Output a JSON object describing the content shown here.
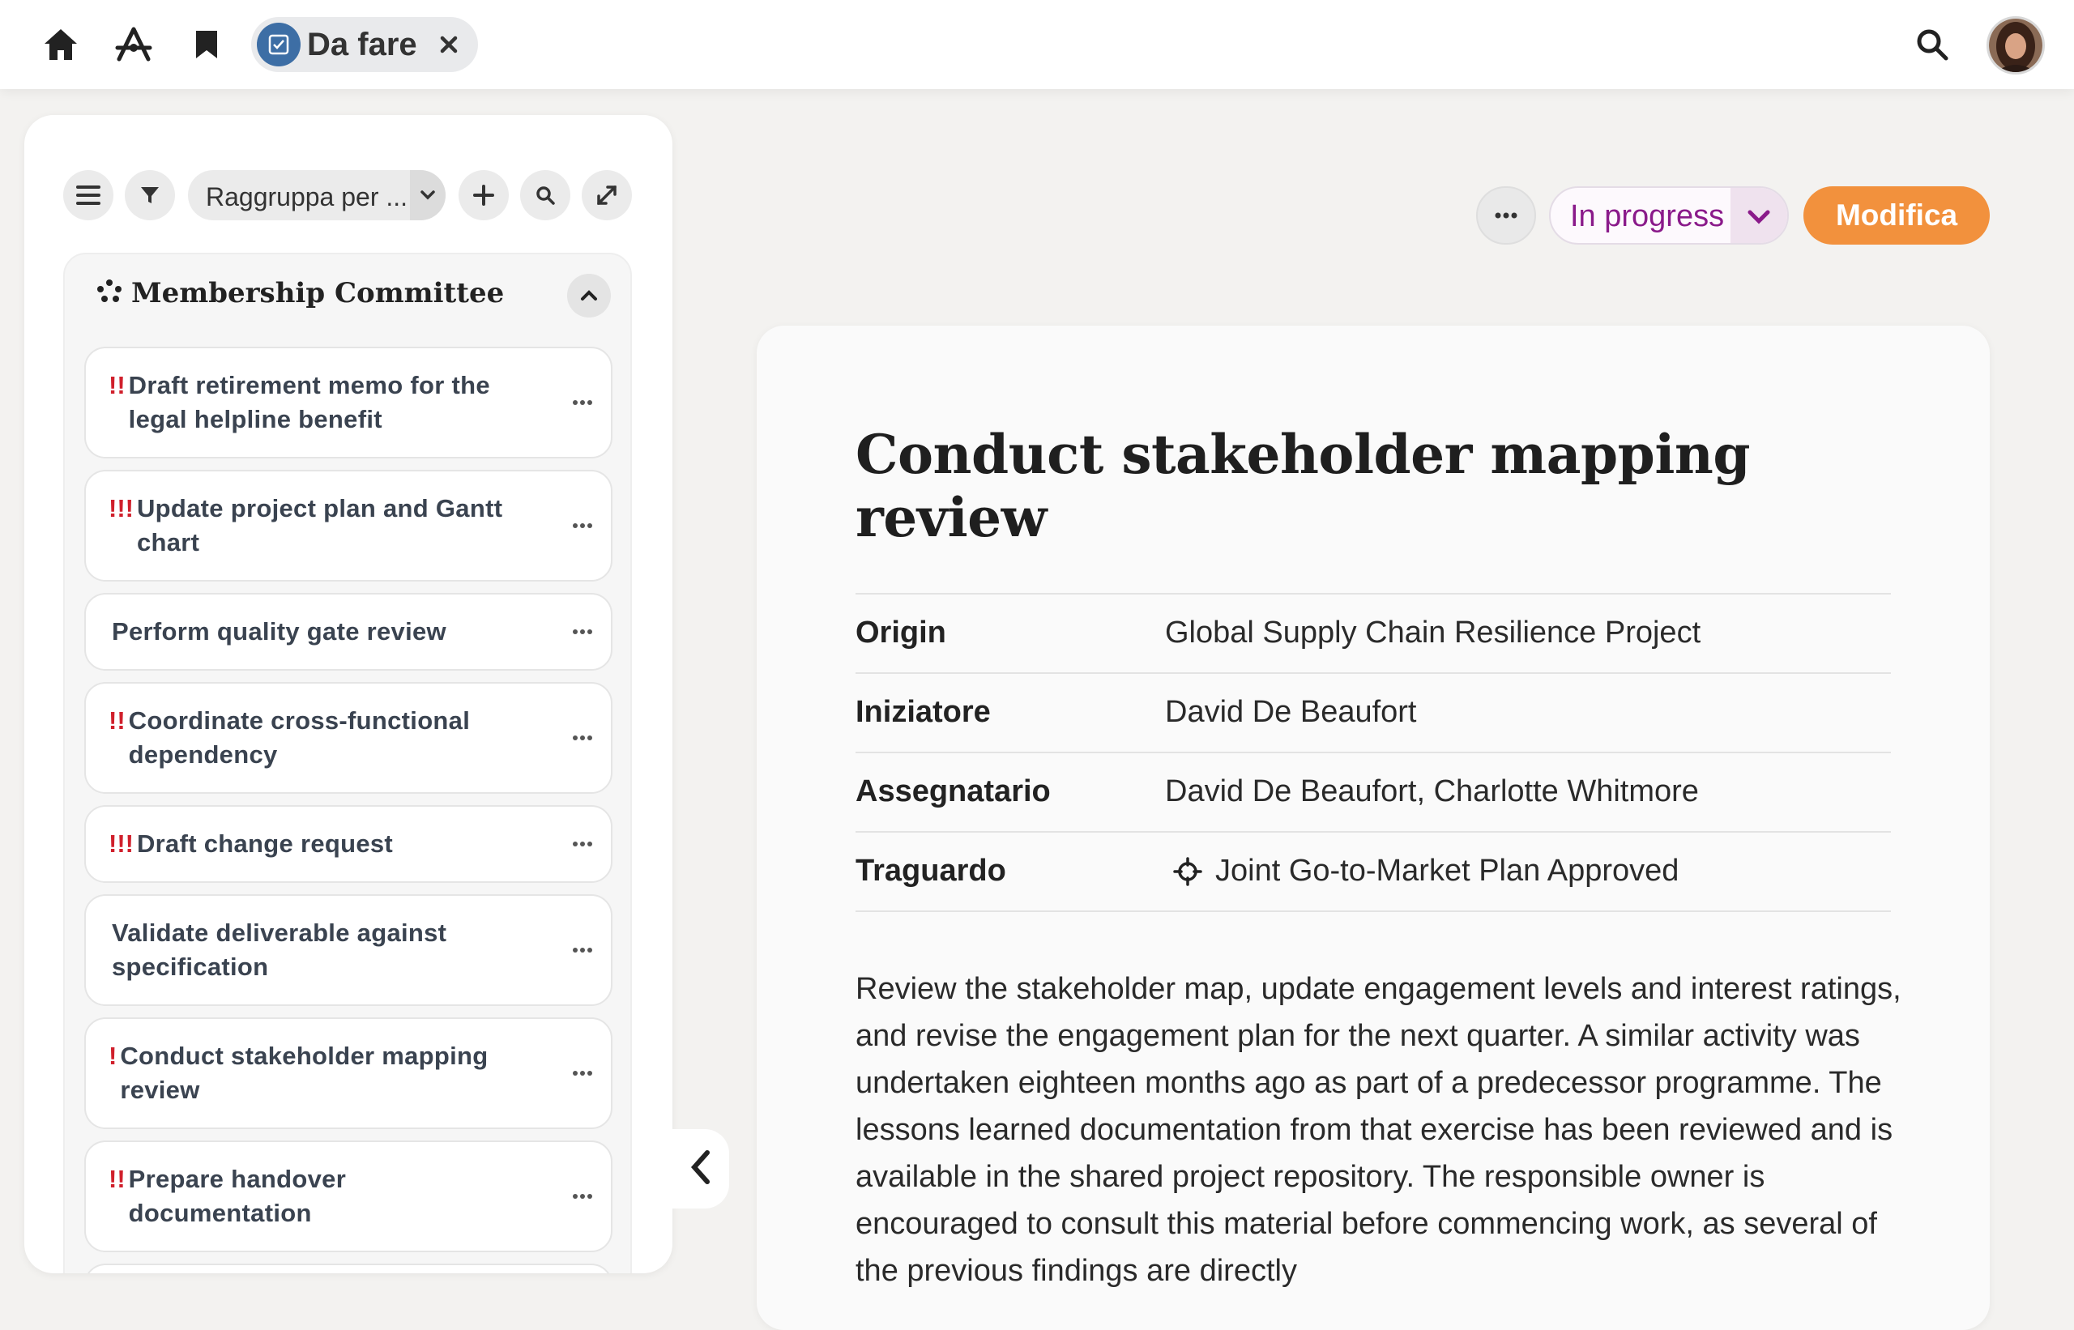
{
  "topbar": {
    "active_tab": {
      "label": "Da fare"
    }
  },
  "sidebar": {
    "group_by": {
      "label": "Raggruppa per ..."
    },
    "group": {
      "title": "Membership Committee",
      "tasks": [
        {
          "priority": "!!",
          "title": "Draft retirement memo for the legal helpline benefit"
        },
        {
          "priority": "!!!",
          "title": "Update project plan and Gantt chart"
        },
        {
          "priority": "",
          "title": "Perform quality gate review"
        },
        {
          "priority": "!!",
          "title": "Coordinate cross-functional dependency"
        },
        {
          "priority": "!!!",
          "title": "Draft change request"
        },
        {
          "priority": "",
          "title": "Validate deliverable against specification"
        },
        {
          "priority": "!",
          "title": "Conduct stakeholder mapping review"
        },
        {
          "priority": "!!",
          "title": "Prepare handover documentation"
        }
      ]
    }
  },
  "detail": {
    "status": {
      "label": "In progress",
      "color": "#8a1a8a"
    },
    "edit_button": {
      "label": "Modifica",
      "color": "#f2913d"
    },
    "title": "Conduct stakeholder mapping review",
    "properties": [
      {
        "key": "Origin",
        "value": "Global Supply Chain Resilience Project"
      },
      {
        "key": "Iniziatore",
        "value": "David De Beaufort"
      },
      {
        "key": "Assegnatario",
        "value": "David De Beaufort, Charlotte Whitmore"
      },
      {
        "key": "Traguardo",
        "value": "Joint Go-to-Market Plan Approved",
        "icon": "milestone-icon"
      }
    ],
    "description": "Review the stakeholder map, update engagement levels and interest ratings, and revise the engagement plan for the next quarter. A similar activity was undertaken eighteen months ago as part of a predecessor programme. The lessons learned documentation from that exercise has been reviewed and is available in the shared project repository. The responsible owner is encouraged to consult this material before commencing work, as several of the previous findings are directly"
  },
  "colors": {
    "priority": "#d0202c",
    "chip_badge": "#3d6ea5"
  }
}
